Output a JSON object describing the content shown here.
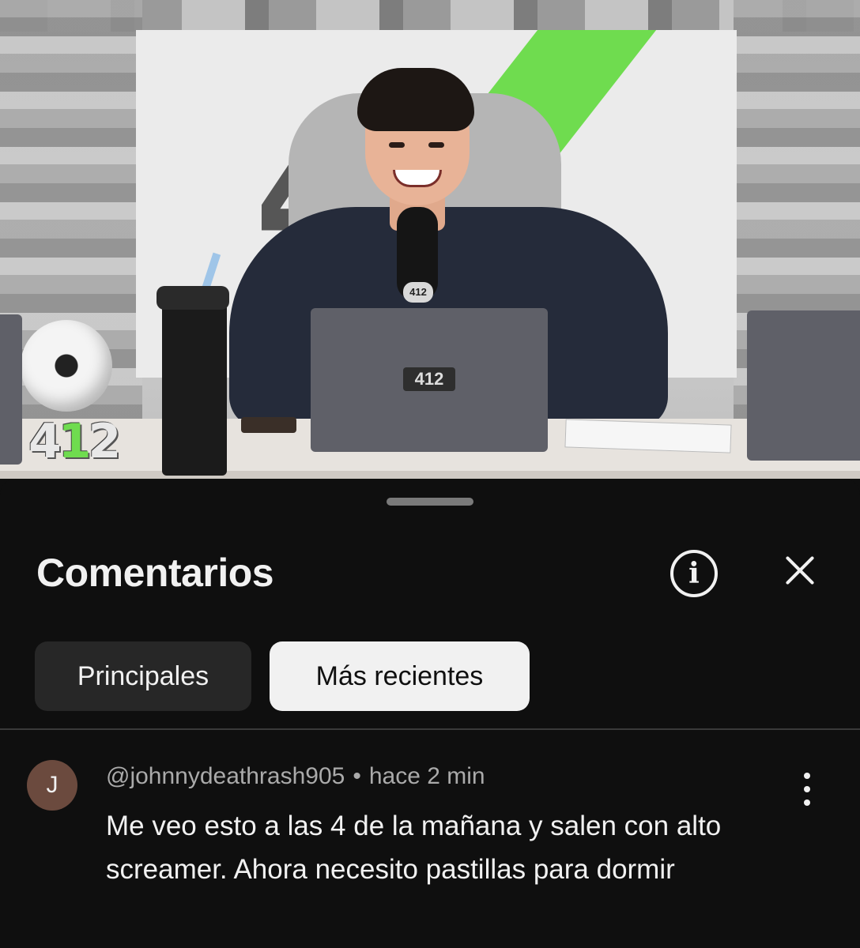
{
  "video": {
    "logo_text": "412",
    "corner_logo_prefix": "4",
    "corner_logo_one": "1",
    "corner_logo_suffix": "2",
    "mic_badge": "412",
    "laptop_logo": "412",
    "colors": {
      "brand_green": "#6fdc4f"
    }
  },
  "comments_panel": {
    "title": "Comentarios",
    "info_icon": "info-icon",
    "close_icon": "close-icon",
    "filters": [
      {
        "label": "Principales",
        "selected": false
      },
      {
        "label": "Más recientes",
        "selected": true
      }
    ],
    "comments": [
      {
        "avatar_initial": "J",
        "author": "@johnnydeathrash905",
        "separator": "•",
        "time": "hace 2 min",
        "text": "Me veo esto a las 4 de la mañana y salen con alto screamer. Ahora necesito pastillas para dormir",
        "menu_icon": "more-vert-icon"
      }
    ]
  },
  "colors": {
    "background": "#0f0f0f",
    "chip_active_bg": "#f1f1f1",
    "chip_inactive_bg": "#272727",
    "avatar_bg": "#6b4a3e",
    "meta_text": "#aaaaaa"
  }
}
